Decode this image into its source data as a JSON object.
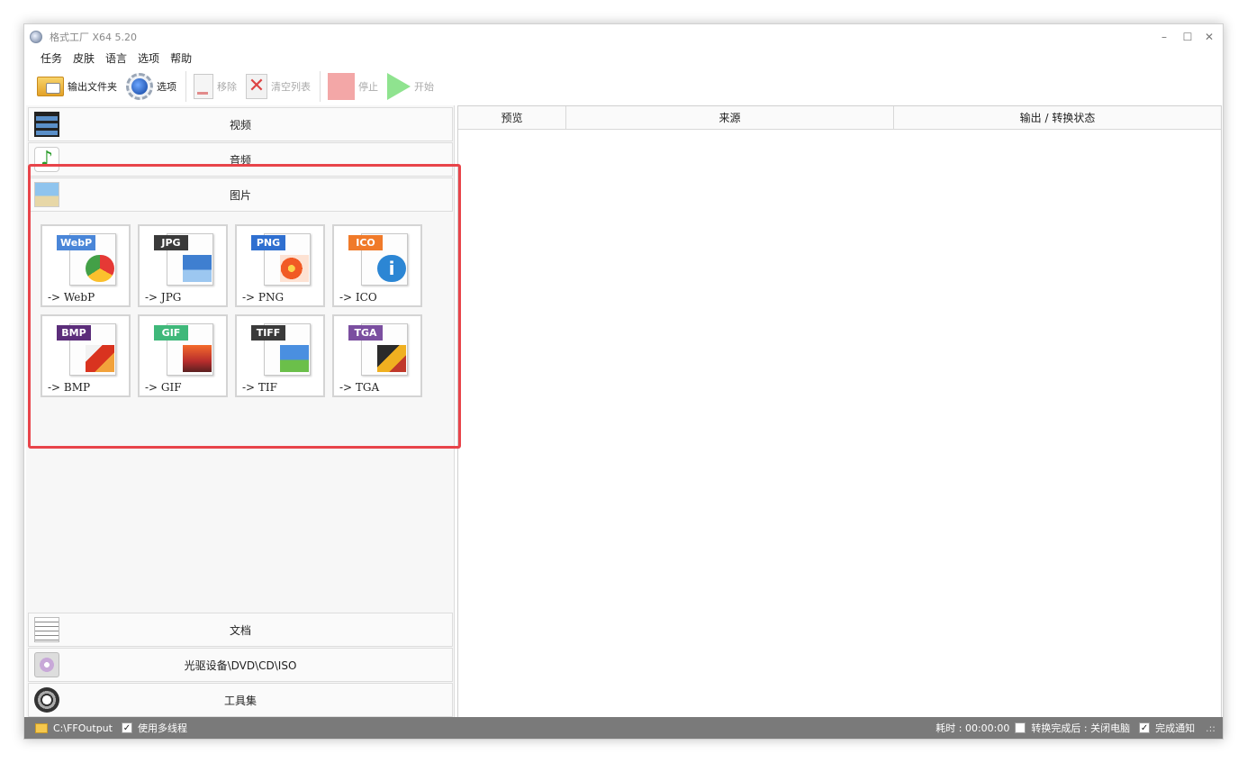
{
  "window": {
    "title": "格式工厂 X64 5.20",
    "controls": {
      "minimize": "–",
      "maximize": "☐",
      "close": "✕"
    }
  },
  "menu": [
    "任务",
    "皮肤",
    "语言",
    "选项",
    "帮助"
  ],
  "toolbar": {
    "output_folder": "输出文件夹",
    "options": "选项",
    "remove": "移除",
    "clear_list": "清空列表",
    "stop": "停止",
    "start": "开始"
  },
  "categories": {
    "video": "视频",
    "audio": "音频",
    "image": "图片",
    "document": "文档",
    "disc": "光驱设备\\DVD\\CD\\ISO",
    "tools": "工具集"
  },
  "image_formats": [
    {
      "badge": "WebP",
      "label": "-> WebP",
      "color": "#4a86d8"
    },
    {
      "badge": "JPG",
      "label": "-> JPG",
      "color": "#3a3a3a"
    },
    {
      "badge": "PNG",
      "label": "-> PNG",
      "color": "#2f6fd0"
    },
    {
      "badge": "ICO",
      "label": "-> ICO",
      "color": "#f07a2a"
    },
    {
      "badge": "BMP",
      "label": "-> BMP",
      "color": "#5b2d7a"
    },
    {
      "badge": "GIF",
      "label": "-> GIF",
      "color": "#3fb87a"
    },
    {
      "badge": "TIFF",
      "label": "-> TIF",
      "color": "#3a3a3a"
    },
    {
      "badge": "TGA",
      "label": "-> TGA",
      "color": "#7b4fa0"
    }
  ],
  "table": {
    "columns": [
      "预览",
      "来源",
      "输出 / 转换状态"
    ]
  },
  "status": {
    "output_path": "C:\\FFOutput",
    "multithread_label": "使用多线程",
    "multithread_checked": "✓",
    "elapsed": "耗时 : 00:00:00",
    "after_convert_label": "转换完成后 : 关闭电脑",
    "notify_label": "完成通知",
    "notify_checked": "✓",
    "grip": ".::"
  }
}
